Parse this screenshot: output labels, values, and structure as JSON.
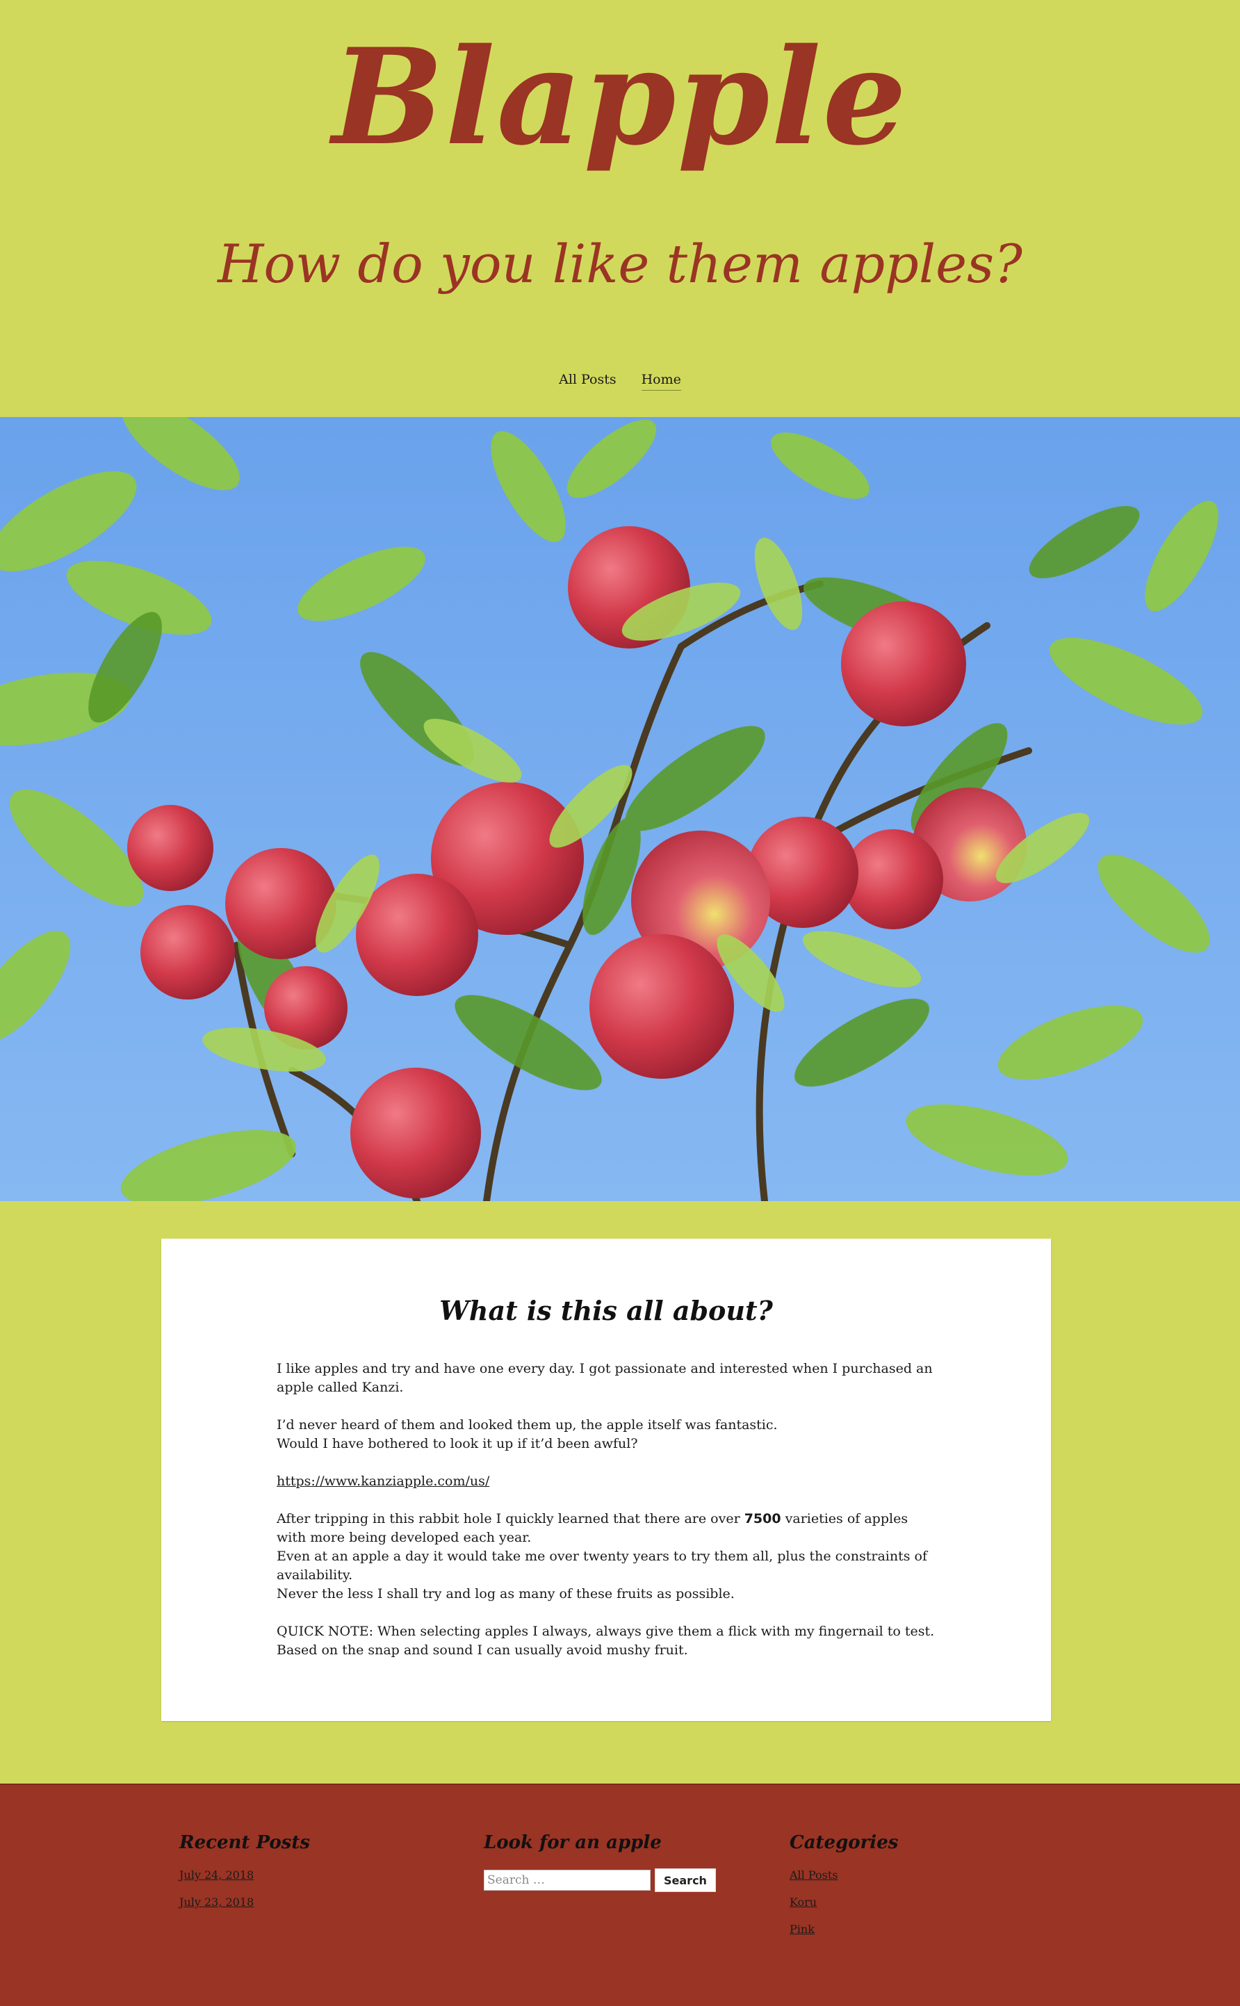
{
  "header": {
    "site_title": "Blapple",
    "tagline": "How do you like them apples?"
  },
  "nav": {
    "items": [
      {
        "label": "All Posts"
      },
      {
        "label": "Home"
      }
    ]
  },
  "hero": {
    "image": "apple-tree-branch-with-red-apples-against-blue-sky",
    "colors": {
      "sky": "#78adf0",
      "leaf": "#7db83a",
      "apple": "#d23a4a"
    }
  },
  "post": {
    "title": "What is this all about?",
    "p1": "I like apples and try and have one every day. I got passionate and interested when I purchased an apple called Kanzi.",
    "p2_line1": "I’d never heard of them and looked them up, the apple itself was fantastic.",
    "p2_line2": "Would I have bothered to look it up if it’d been awful?",
    "link": "https://www.kanziapple.com/us/",
    "p4_before": "After tripping in this rabbit hole I quickly learned that there are over ",
    "p4_bold": "7500",
    "p4_after": " varieties of apples with more being developed each year.",
    "p4_line2": "Even at an apple a day it would take me over twenty years to try them all, plus the constraints of availability.",
    "p4_line3": "Never the less I shall try and log as many of these fruits as possible.",
    "p5": "QUICK NOTE: When selecting apples I always, always give them a flick with my fingernail to test. Based on the snap and sound I can usually avoid mushy fruit."
  },
  "footer": {
    "recent_posts": {
      "title": "Recent Posts",
      "items": [
        {
          "label": "July 24, 2018"
        },
        {
          "label": "July 23, 2018"
        }
      ]
    },
    "search": {
      "title": "Look for an apple",
      "placeholder": "Search …",
      "button_label": "Search"
    },
    "categories": {
      "title": "Categories",
      "items": [
        {
          "label": "All Posts"
        },
        {
          "label": "Koru"
        },
        {
          "label": "Pink"
        }
      ]
    }
  },
  "colors": {
    "page_bg": "#d1d95c",
    "accent_red": "#9a3424",
    "card_bg": "#ffffff"
  }
}
